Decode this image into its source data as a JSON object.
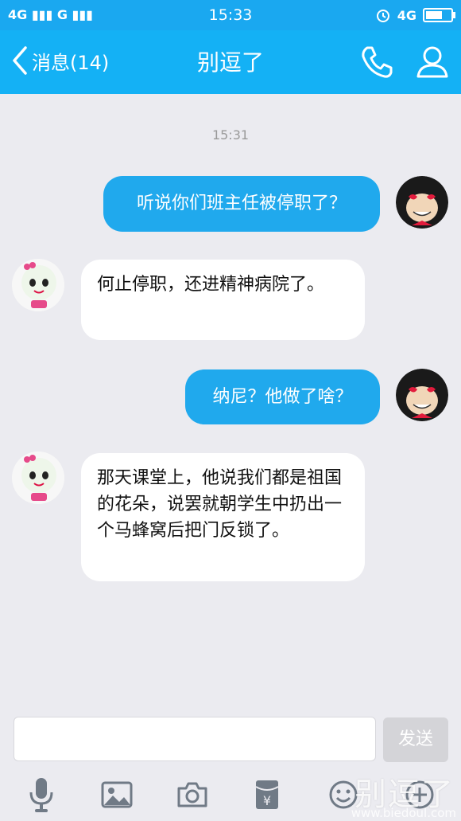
{
  "status_bar": {
    "network_left": "4G ▮▮▮ G ▮▮▮",
    "time": "15:33",
    "network_right": "4G"
  },
  "header": {
    "back_label": "消息(14)",
    "title": "别逗了"
  },
  "chat": {
    "timestamp": "15:31",
    "messages": [
      {
        "sender": "me",
        "text": "听说你们班主任被停职了？"
      },
      {
        "sender": "other",
        "text": "何止停职，还进精神病院了。"
      },
      {
        "sender": "me",
        "text": "纳尼？他做了啥？"
      },
      {
        "sender": "other",
        "text": "那天课堂上，他说我们都是祖国的花朵，说罢就朝学生中扔出一个马蜂窝后把门反锁了。"
      }
    ]
  },
  "input": {
    "placeholder": "",
    "send_label": "发送"
  },
  "toolbar": {
    "icons": [
      "microphone-icon",
      "image-icon",
      "camera-icon",
      "red-packet-icon",
      "emoji-icon",
      "plus-icon"
    ]
  },
  "watermark": {
    "text": "别逗了",
    "url": "www.biedoul.com"
  },
  "colors": {
    "header": "#14b1f5",
    "bubble_me": "#20a9ed",
    "bubble_other": "#ffffff",
    "background": "#ebebf0"
  }
}
